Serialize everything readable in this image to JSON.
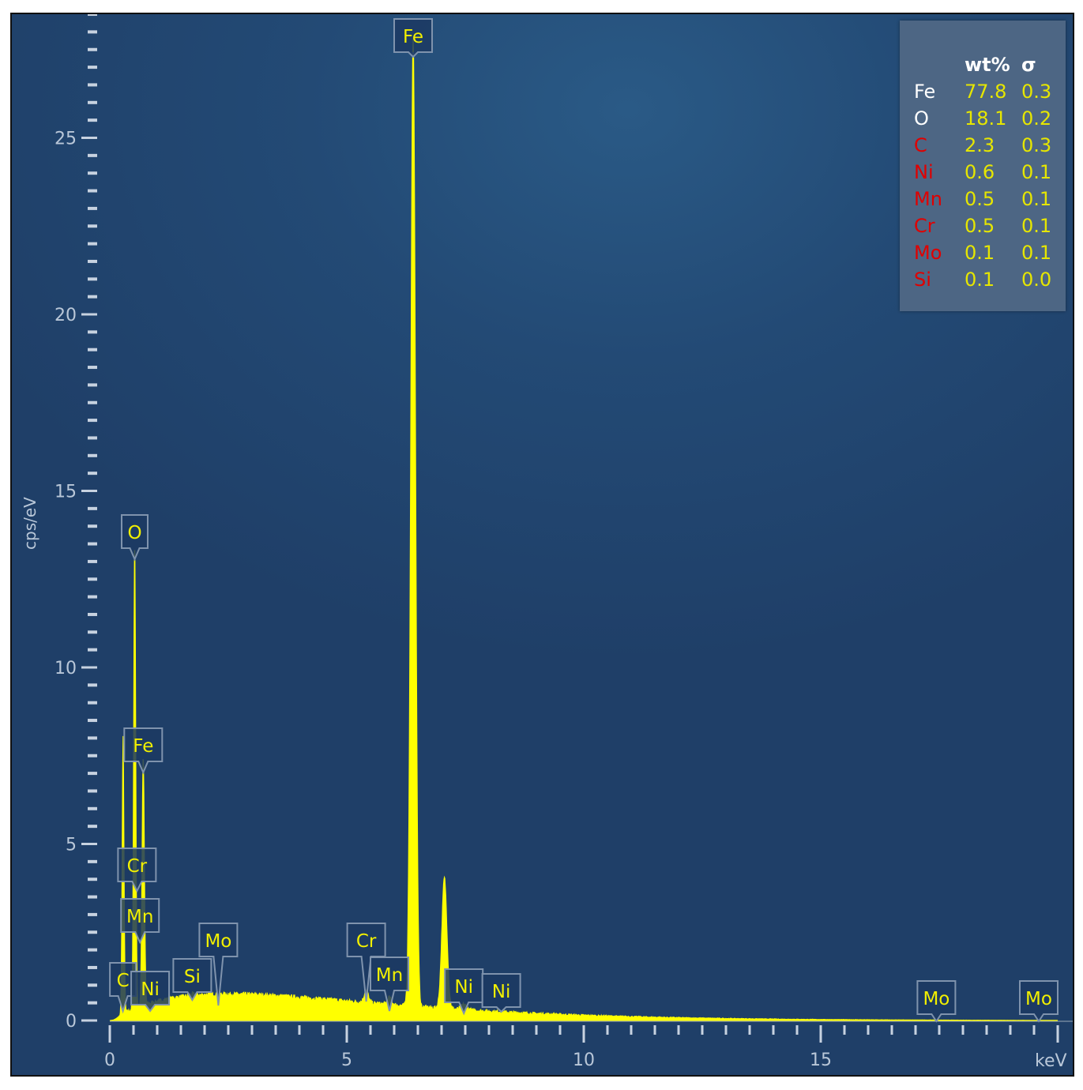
{
  "chart_data": {
    "type": "line",
    "title": "",
    "xlabel": "keV",
    "ylabel": "cps/eV",
    "xlim": [
      0,
      20
    ],
    "ylim": [
      0,
      28.5
    ],
    "x_ticks": [
      0,
      5,
      10,
      15
    ],
    "y_ticks": [
      0,
      5,
      10,
      15,
      20,
      25
    ],
    "series_color": "#ffff00",
    "background": {
      "shape": "bremsstrahlung",
      "max_value": 0.75,
      "max_at_kev": 2.5
    },
    "peaks": [
      {
        "element": "C",
        "kev": 0.28,
        "height": 7.8,
        "sigma": 0.02
      },
      {
        "element": "O",
        "kev": 0.525,
        "height": 13.3,
        "sigma": 0.022
      },
      {
        "element": "Fe",
        "kev": 0.705,
        "height": 7.1,
        "sigma": 0.025
      },
      {
        "element": "Si",
        "kev": 1.74,
        "height": 0.05,
        "sigma": 0.04
      },
      {
        "element": "Cr",
        "kev": 5.41,
        "height": 0.35,
        "sigma": 0.045
      },
      {
        "element": "Mn",
        "kev": 5.9,
        "height": 0.2,
        "sigma": 0.045
      },
      {
        "element": "Fe",
        "kev": 6.4,
        "height": 27.5,
        "sigma": 0.05
      },
      {
        "element": "Fe",
        "kev": 7.06,
        "height": 3.7,
        "sigma": 0.055
      },
      {
        "element": "Ni",
        "kev": 7.47,
        "height": 0.15,
        "sigma": 0.055
      }
    ],
    "peak_labels": [
      {
        "element": "Fe",
        "kev": 6.4
      },
      {
        "element": "O",
        "kev": 0.525
      },
      {
        "element": "Fe",
        "kev": 0.705
      },
      {
        "element": "Cr",
        "kev": 0.573
      },
      {
        "element": "Mn",
        "kev": 0.637
      },
      {
        "element": "C",
        "kev": 0.277
      },
      {
        "element": "Ni",
        "kev": 0.851
      },
      {
        "element": "Si",
        "kev": 1.74
      },
      {
        "element": "Mo",
        "kev": 2.29
      },
      {
        "element": "Cr",
        "kev": 5.41
      },
      {
        "element": "Mn",
        "kev": 5.9
      },
      {
        "element": "Ni",
        "kev": 7.47
      },
      {
        "element": "Ni",
        "kev": 8.26
      },
      {
        "element": "Mo",
        "kev": 17.44
      },
      {
        "element": "Mo",
        "kev": 19.6
      }
    ]
  },
  "results": {
    "header": {
      "wt": "wt%",
      "sigma": "σ"
    },
    "rows": [
      {
        "element": "Fe",
        "wt": "77.8",
        "sigma": "0.3",
        "color": "#ffffff"
      },
      {
        "element": "O",
        "wt": "18.1",
        "sigma": "0.2",
        "color": "#ffffff"
      },
      {
        "element": "C",
        "wt": "2.3",
        "sigma": "0.3",
        "color": "#e00000"
      },
      {
        "element": "Ni",
        "wt": "0.6",
        "sigma": "0.1",
        "color": "#e00000"
      },
      {
        "element": "Mn",
        "wt": "0.5",
        "sigma": "0.1",
        "color": "#e00000"
      },
      {
        "element": "Cr",
        "wt": "0.5",
        "sigma": "0.1",
        "color": "#e00000"
      },
      {
        "element": "Mo",
        "wt": "0.1",
        "sigma": "0.1",
        "color": "#e00000"
      },
      {
        "element": "Si",
        "wt": "0.1",
        "sigma": "0.0",
        "color": "#e00000"
      }
    ],
    "value_color": "#e6e600"
  }
}
